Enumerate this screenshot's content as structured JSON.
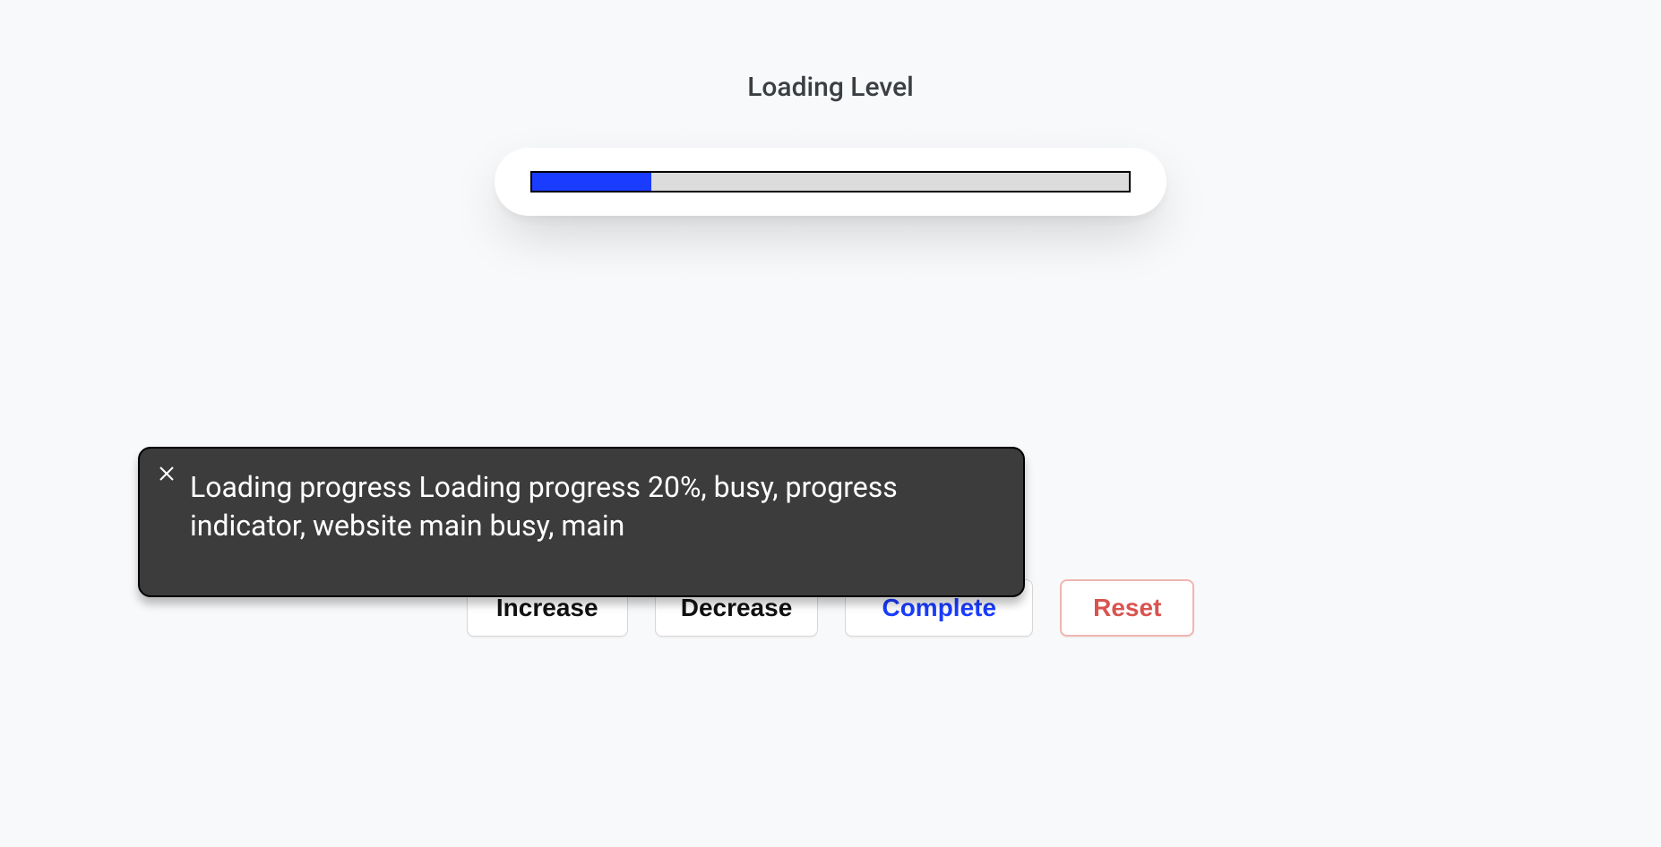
{
  "title": "Loading Level",
  "progress": {
    "percent": 20
  },
  "buttons": {
    "increase": "Increase",
    "decrease": "Decrease",
    "complete": "Complete",
    "reset": "Reset"
  },
  "tooltip": {
    "text": "Loading progress Loading progress 20%, busy, progress indicator, website main busy, main"
  }
}
